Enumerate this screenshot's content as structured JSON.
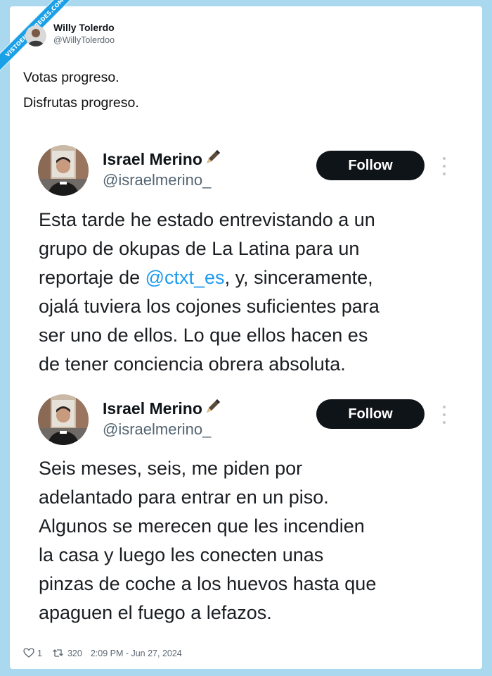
{
  "watermark": {
    "text": "VISTOENLASREDES.COM"
  },
  "outer_tweet": {
    "author_name": "Willy Tolerdo",
    "author_handle": "@WillyTolerdoo",
    "lines": [
      "Votas progreso.",
      "Disfrutas progreso."
    ]
  },
  "quoted_tweets": [
    {
      "author_name": "Israel Merino",
      "author_emoji": "pen-icon",
      "author_handle": "@israelmerino_",
      "follow_label": "Follow",
      "text_before": "Esta tarde he estado entrevistando a un\ngrupo de okupas de La Latina para un\nreportaje de ",
      "mention": "@ctxt_es",
      "text_after": ", y, sinceramente,\nojalá tuviera los cojones suficientes para\nser uno de ellos. Lo que ellos hacen es\nde tener conciencia obrera absoluta."
    },
    {
      "author_name": "Israel Merino",
      "author_emoji": "pen-icon",
      "author_handle": "@israelmerino_",
      "follow_label": "Follow",
      "text": "Seis meses, seis, me piden por\nadelantado para entrar en un piso.\nAlgunos se merecen que les incendien\nla casa y luego les conecten unas\npinzas de coche a los huevos hasta que\napaguen el fuego a lefazos."
    }
  ],
  "footer": {
    "likes": "1",
    "retweets": "320",
    "timestamp": "2:09 PM - Jun 27, 2024",
    "like_icon": "heart-icon",
    "retweet_icon": "retweet-icon"
  },
  "colors": {
    "background": "#a9d8ef",
    "card": "#ffffff",
    "accent": "#1d9bf0",
    "follow_button": "#0f1419"
  }
}
